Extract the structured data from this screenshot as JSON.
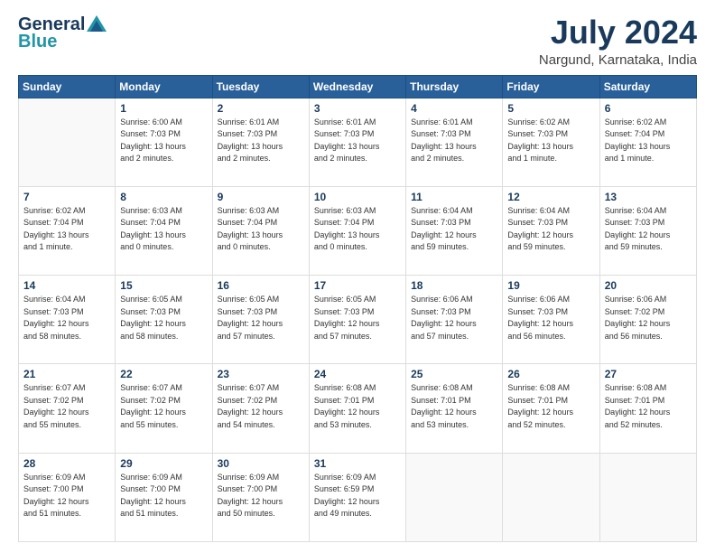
{
  "header": {
    "logo_line1": "General",
    "logo_line2": "Blue",
    "main_title": "July 2024",
    "subtitle": "Nargund, Karnataka, India"
  },
  "calendar": {
    "days_of_week": [
      "Sunday",
      "Monday",
      "Tuesday",
      "Wednesday",
      "Thursday",
      "Friday",
      "Saturday"
    ],
    "weeks": [
      [
        {
          "day": "",
          "info": ""
        },
        {
          "day": "1",
          "info": "Sunrise: 6:00 AM\nSunset: 7:03 PM\nDaylight: 13 hours\nand 2 minutes."
        },
        {
          "day": "2",
          "info": "Sunrise: 6:01 AM\nSunset: 7:03 PM\nDaylight: 13 hours\nand 2 minutes."
        },
        {
          "day": "3",
          "info": "Sunrise: 6:01 AM\nSunset: 7:03 PM\nDaylight: 13 hours\nand 2 minutes."
        },
        {
          "day": "4",
          "info": "Sunrise: 6:01 AM\nSunset: 7:03 PM\nDaylight: 13 hours\nand 2 minutes."
        },
        {
          "day": "5",
          "info": "Sunrise: 6:02 AM\nSunset: 7:03 PM\nDaylight: 13 hours\nand 1 minute."
        },
        {
          "day": "6",
          "info": "Sunrise: 6:02 AM\nSunset: 7:04 PM\nDaylight: 13 hours\nand 1 minute."
        }
      ],
      [
        {
          "day": "7",
          "info": "Sunrise: 6:02 AM\nSunset: 7:04 PM\nDaylight: 13 hours\nand 1 minute."
        },
        {
          "day": "8",
          "info": "Sunrise: 6:03 AM\nSunset: 7:04 PM\nDaylight: 13 hours\nand 0 minutes."
        },
        {
          "day": "9",
          "info": "Sunrise: 6:03 AM\nSunset: 7:04 PM\nDaylight: 13 hours\nand 0 minutes."
        },
        {
          "day": "10",
          "info": "Sunrise: 6:03 AM\nSunset: 7:04 PM\nDaylight: 13 hours\nand 0 minutes."
        },
        {
          "day": "11",
          "info": "Sunrise: 6:04 AM\nSunset: 7:03 PM\nDaylight: 12 hours\nand 59 minutes."
        },
        {
          "day": "12",
          "info": "Sunrise: 6:04 AM\nSunset: 7:03 PM\nDaylight: 12 hours\nand 59 minutes."
        },
        {
          "day": "13",
          "info": "Sunrise: 6:04 AM\nSunset: 7:03 PM\nDaylight: 12 hours\nand 59 minutes."
        }
      ],
      [
        {
          "day": "14",
          "info": "Sunrise: 6:04 AM\nSunset: 7:03 PM\nDaylight: 12 hours\nand 58 minutes."
        },
        {
          "day": "15",
          "info": "Sunrise: 6:05 AM\nSunset: 7:03 PM\nDaylight: 12 hours\nand 58 minutes."
        },
        {
          "day": "16",
          "info": "Sunrise: 6:05 AM\nSunset: 7:03 PM\nDaylight: 12 hours\nand 57 minutes."
        },
        {
          "day": "17",
          "info": "Sunrise: 6:05 AM\nSunset: 7:03 PM\nDaylight: 12 hours\nand 57 minutes."
        },
        {
          "day": "18",
          "info": "Sunrise: 6:06 AM\nSunset: 7:03 PM\nDaylight: 12 hours\nand 57 minutes."
        },
        {
          "day": "19",
          "info": "Sunrise: 6:06 AM\nSunset: 7:03 PM\nDaylight: 12 hours\nand 56 minutes."
        },
        {
          "day": "20",
          "info": "Sunrise: 6:06 AM\nSunset: 7:02 PM\nDaylight: 12 hours\nand 56 minutes."
        }
      ],
      [
        {
          "day": "21",
          "info": "Sunrise: 6:07 AM\nSunset: 7:02 PM\nDaylight: 12 hours\nand 55 minutes."
        },
        {
          "day": "22",
          "info": "Sunrise: 6:07 AM\nSunset: 7:02 PM\nDaylight: 12 hours\nand 55 minutes."
        },
        {
          "day": "23",
          "info": "Sunrise: 6:07 AM\nSunset: 7:02 PM\nDaylight: 12 hours\nand 54 minutes."
        },
        {
          "day": "24",
          "info": "Sunrise: 6:08 AM\nSunset: 7:01 PM\nDaylight: 12 hours\nand 53 minutes."
        },
        {
          "day": "25",
          "info": "Sunrise: 6:08 AM\nSunset: 7:01 PM\nDaylight: 12 hours\nand 53 minutes."
        },
        {
          "day": "26",
          "info": "Sunrise: 6:08 AM\nSunset: 7:01 PM\nDaylight: 12 hours\nand 52 minutes."
        },
        {
          "day": "27",
          "info": "Sunrise: 6:08 AM\nSunset: 7:01 PM\nDaylight: 12 hours\nand 52 minutes."
        }
      ],
      [
        {
          "day": "28",
          "info": "Sunrise: 6:09 AM\nSunset: 7:00 PM\nDaylight: 12 hours\nand 51 minutes."
        },
        {
          "day": "29",
          "info": "Sunrise: 6:09 AM\nSunset: 7:00 PM\nDaylight: 12 hours\nand 51 minutes."
        },
        {
          "day": "30",
          "info": "Sunrise: 6:09 AM\nSunset: 7:00 PM\nDaylight: 12 hours\nand 50 minutes."
        },
        {
          "day": "31",
          "info": "Sunrise: 6:09 AM\nSunset: 6:59 PM\nDaylight: 12 hours\nand 49 minutes."
        },
        {
          "day": "",
          "info": ""
        },
        {
          "day": "",
          "info": ""
        },
        {
          "day": "",
          "info": ""
        }
      ]
    ]
  }
}
